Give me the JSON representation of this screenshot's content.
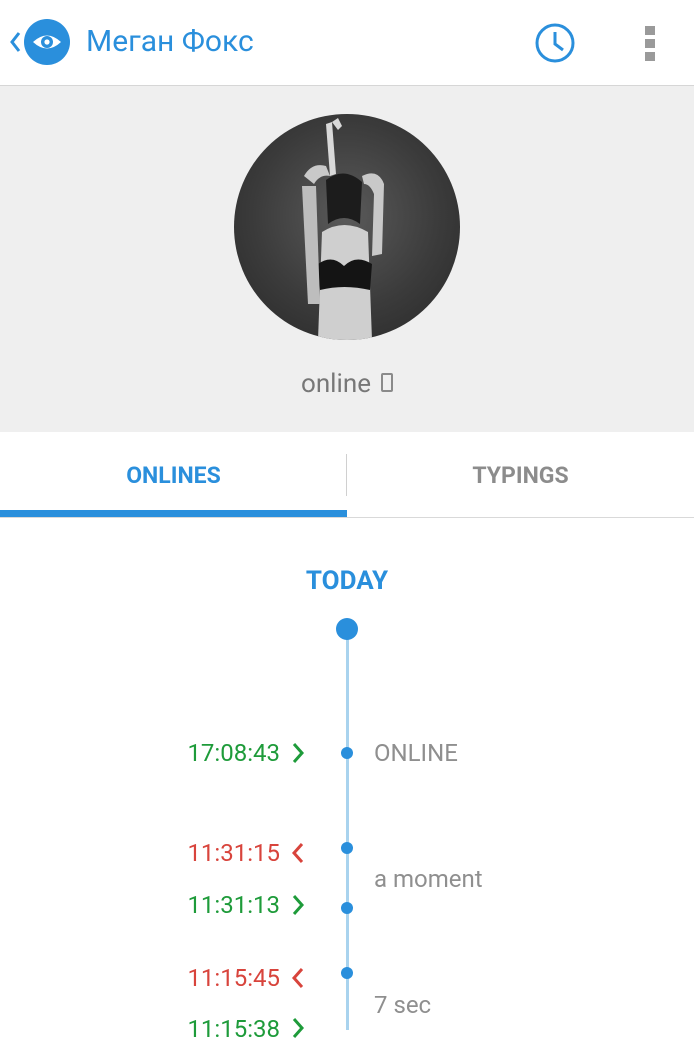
{
  "header": {
    "title": "Меган Фокс",
    "back_icon": "chevron-left-icon",
    "logo_icon": "eye-icon",
    "history_icon": "clock-icon",
    "menu_icon": "more-vertical-icon",
    "accent_color": "#2a8fdc"
  },
  "profile": {
    "avatar": "profile-photo",
    "status_text": "online",
    "status_icon": "phone-icon",
    "background_color": "#efefef"
  },
  "tabs": [
    {
      "label": "ONLINES",
      "active": true
    },
    {
      "label": "TYPINGS",
      "active": false
    }
  ],
  "timeline": {
    "day_label": "TODAY",
    "colors": {
      "online": "#1e9b3a",
      "offline": "#d8443c",
      "line": "#a9d3ee"
    },
    "entries": [
      {
        "time": "17:08:43",
        "direction": "in",
        "icon": "chevron-right-icon"
      },
      {
        "time": "11:31:15",
        "direction": "out",
        "icon": "chevron-left-icon"
      },
      {
        "time": "11:31:13",
        "direction": "in",
        "icon": "chevron-right-icon"
      },
      {
        "time": "11:15:45",
        "direction": "out",
        "icon": "chevron-left-icon"
      },
      {
        "time": "11:15:38",
        "direction": "in",
        "icon": "chevron-right-icon"
      }
    ],
    "durations": [
      "ONLINE",
      "a moment",
      "7 sec"
    ]
  }
}
